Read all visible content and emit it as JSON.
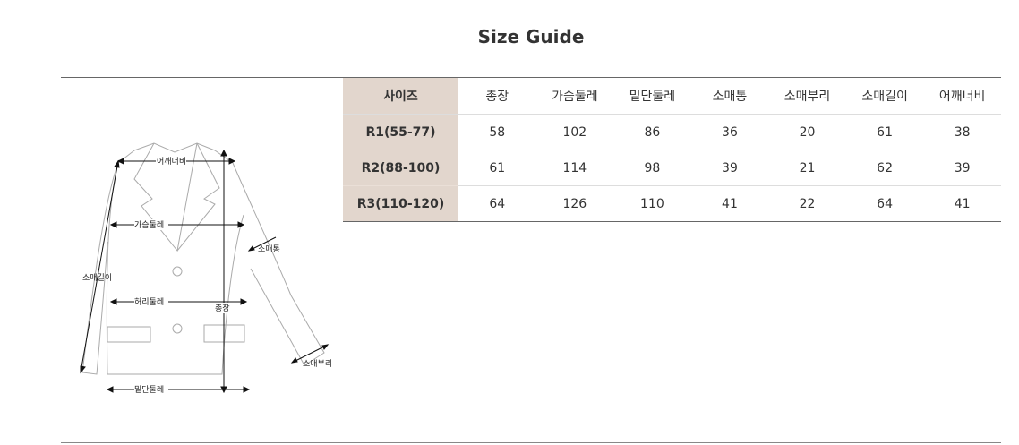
{
  "title": "Size Guide",
  "table": {
    "corner": "사이즈",
    "columns": [
      "총장",
      "가슴둘레",
      "밑단둘레",
      "소매통",
      "소매부리",
      "소매길이",
      "어깨너비"
    ],
    "rows": [
      {
        "size": "R1(55-77)",
        "values": [
          "58",
          "102",
          "86",
          "36",
          "20",
          "61",
          "38"
        ]
      },
      {
        "size": "R2(88-100)",
        "values": [
          "61",
          "114",
          "98",
          "39",
          "21",
          "62",
          "39"
        ]
      },
      {
        "size": "R3(110-120)",
        "values": [
          "64",
          "126",
          "110",
          "41",
          "22",
          "64",
          "41"
        ]
      }
    ]
  },
  "diagram": {
    "shoulder": "어깨너비",
    "chest": "가슴둘레",
    "sleeve_width": "소매통",
    "sleeve_length": "소매길이",
    "waist": "허리둘레",
    "length": "총장",
    "sleeve_cuff": "소매부리",
    "hem": "밑단둘레"
  }
}
